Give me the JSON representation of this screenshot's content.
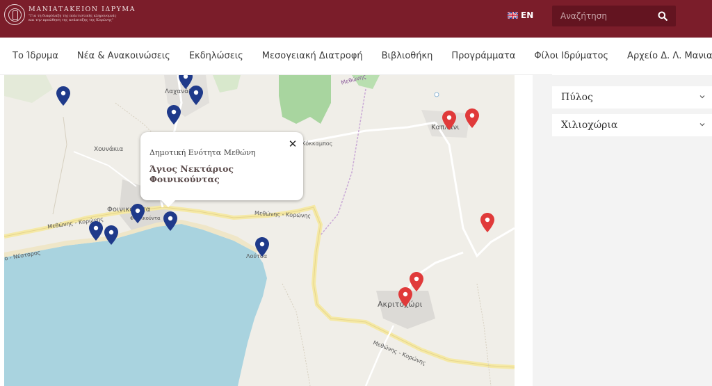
{
  "header": {
    "logo_name": "ΜΑΝΙΑΤΑΚΕΙΟΝ ΙΔΡΥΜΑ",
    "logo_tagline": "\"Για τη διαφύλαξη της πολιτιστικής κληρονομιάς και την προώθηση της ανάπτυξης της Κορώνης\"",
    "lang_label": "EN",
    "search_placeholder": "Αναζήτηση"
  },
  "nav": {
    "items": [
      "Το Ίδρυμα",
      "Νέα & Ανακοινώσεις",
      "Εκδηλώσεις",
      "Μεσογειακή Διατροφή",
      "Βιβλιοθήκη",
      "Προγράμματα",
      "Φίλοι Ιδρύματος",
      "Αρχείο Δ. Λ. Μανιατάκη"
    ]
  },
  "map": {
    "places": {
      "lachanada": "Λαχανάδα",
      "chounakia": "Χουνάκια",
      "foinikounta": "Φοινικούντα",
      "foinikounta_small": "Φοινικούντα",
      "loutsa": "Λούτσα",
      "kaplani": "Καπλάνι",
      "akritochori": "Ακριτοχώρι",
      "kokkinokampos": "Κόκκαμπος"
    },
    "roads": {
      "r1": "Μεθώνης - Κορώνης",
      "r2": "Μεθώνης - Κορώνης",
      "r3": "Μεθώνης - Κορώνης",
      "r4": "Μεθώνης",
      "r5": "ο - Νέστορος"
    },
    "colors": {
      "blue_marker": "#1f3a8a",
      "red_marker": "#e03a3a",
      "sea": "#a9d3df",
      "forest": "#a8d59f"
    },
    "popup": {
      "subtitle": "Δημοτική Ενότητα Μεθώνη",
      "title": "Άγιος Νεκτάριος Φοινικούντας",
      "close_icon": "✕"
    }
  },
  "sidebar": {
    "accordions": [
      {
        "label": "Πύλος"
      },
      {
        "label": "Χιλιοχώρια"
      }
    ]
  }
}
